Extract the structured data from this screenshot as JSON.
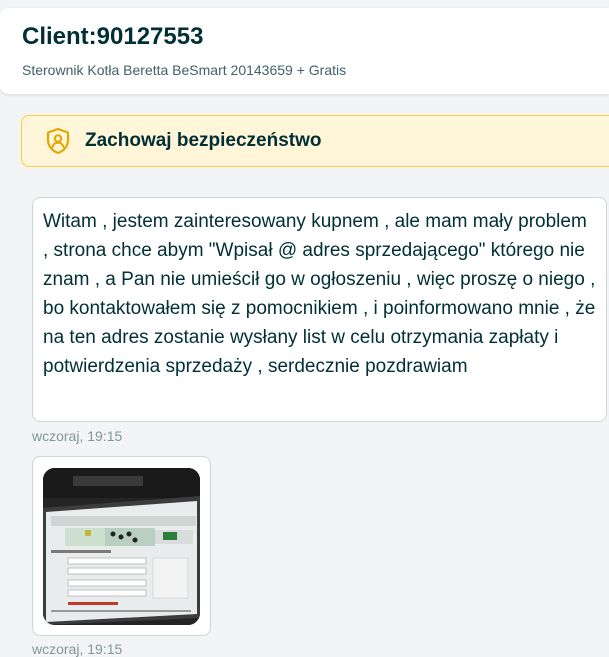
{
  "header": {
    "title": "Client:90127553",
    "subtitle": "Sterownik Kotła Beretta BeSmart 20143659 + Gratis"
  },
  "safety_banner": {
    "icon": "shield-user-icon",
    "label": "Zachowaj bezpieczeństwo",
    "colors": {
      "background": "#fff6d9",
      "border": "#ffce32",
      "icon": "#e0a800"
    }
  },
  "messages": [
    {
      "type": "text",
      "text": "Witam , jestem zainteresowany kupnem , ale mam mały problem , strona chce abym \"Wpisał @ adres sprzedającego\" którego nie znam , a Pan nie umieścił go w ogłoszeniu , więc proszę o niego , bo kontaktowałem się z pomocnikiem , i poinformowano mnie , że na ten adres zostanie wysłany list w celu otrzymania zapłaty i potwierdzenia sprzedaży , serdecznie pozdrawiam",
      "timestamp": "wczoraj, 19:15"
    },
    {
      "type": "image",
      "image_description_icon": "photo-of-laptop-screen",
      "timestamp": "wczoraj, 19:15"
    }
  ]
}
